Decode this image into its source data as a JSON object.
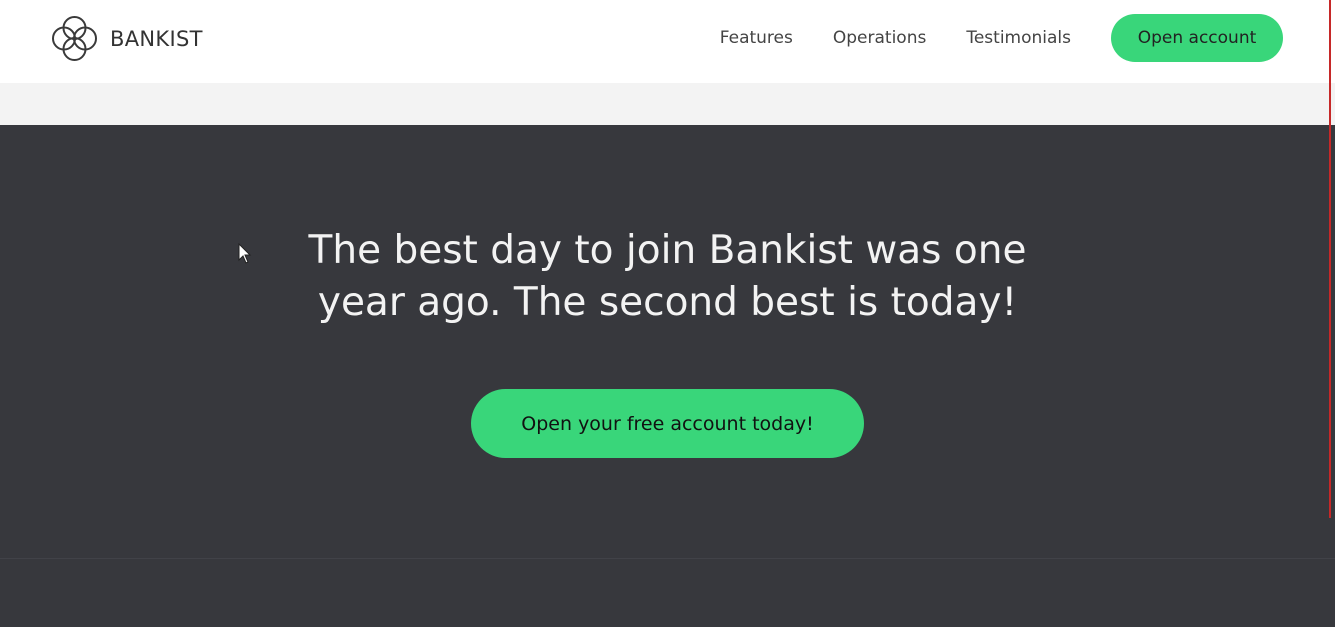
{
  "brand": {
    "name": "BANKIST",
    "logo_icon": "four-rings-logo-icon"
  },
  "nav": {
    "links": [
      {
        "label": "Features"
      },
      {
        "label": "Operations"
      },
      {
        "label": "Testimonials"
      }
    ],
    "cta_label": "Open account"
  },
  "signup": {
    "title_line_1": "The best day to join Bankist was one",
    "title_line_2": "year ago. The second best is today!",
    "cta_label": "Open your free account today!"
  },
  "colors": {
    "accent": "#39d67a",
    "dark_section": "#37383d",
    "strip": "#f3f3f3"
  }
}
